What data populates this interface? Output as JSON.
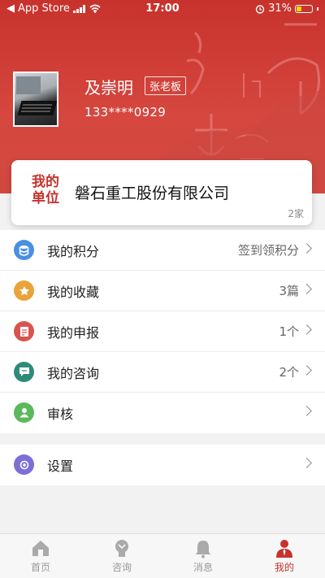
{
  "status_bar": {
    "carrier": "App Store",
    "time": "17:00",
    "battery": "31%",
    "battery_level": 0.31
  },
  "profile": {
    "name": "及崇明",
    "role_badge": "张老板",
    "phone": "133****0929"
  },
  "unit": {
    "label_line1": "我的",
    "label_line2": "单位",
    "name": "磐石重工股份有限公司",
    "count": "2家"
  },
  "menu": {
    "items": [
      {
        "label": "我的积分",
        "value": "签到领积分",
        "icon": "database-icon",
        "color": "#4a90e2"
      },
      {
        "label": "我的收藏",
        "value": "3篇",
        "icon": "star-icon",
        "color": "#e8a33a"
      },
      {
        "label": "我的申报",
        "value": "1个",
        "icon": "document-icon",
        "color": "#d9534f"
      },
      {
        "label": "我的咨询",
        "value": "2个",
        "icon": "chat-icon",
        "color": "#2e8b7a"
      },
      {
        "label": "审核",
        "value": "",
        "icon": "user-icon",
        "color": "#5cb85c"
      }
    ],
    "settings": {
      "label": "设置",
      "icon": "settings-icon",
      "color": "#7b6fd6"
    }
  },
  "tabbar": {
    "tabs": [
      {
        "label": "首页",
        "icon": "home-icon"
      },
      {
        "label": "咨询",
        "icon": "lightbulb-icon"
      },
      {
        "label": "消息",
        "icon": "bell-icon"
      },
      {
        "label": "我的",
        "icon": "person-icon"
      }
    ],
    "active_index": 3,
    "active_color": "#c8322c"
  },
  "theme": {
    "primary": "#c8322c"
  }
}
